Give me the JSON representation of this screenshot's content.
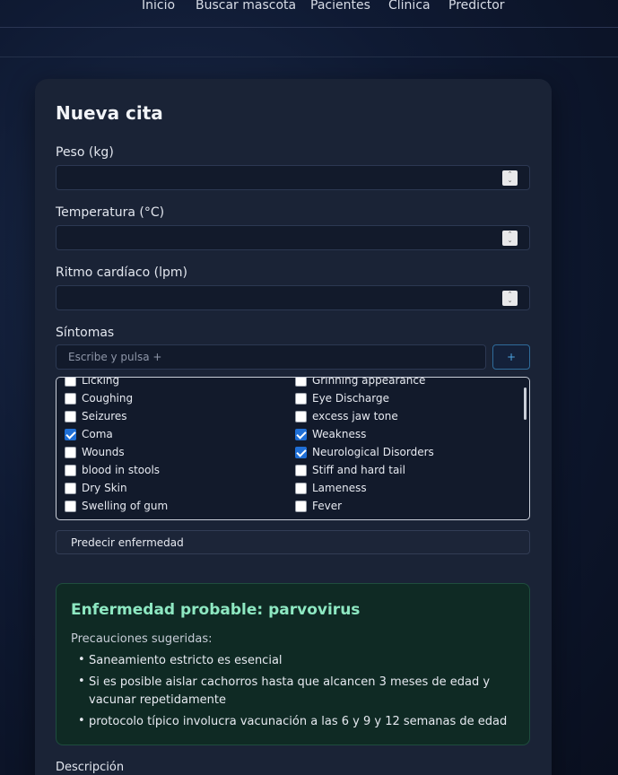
{
  "nav": {
    "items": [
      "Inicio",
      "Buscar mascota",
      "Pacientes",
      "Clínica",
      "Predictor"
    ]
  },
  "form": {
    "title": "Nueva cita",
    "weight_label": "Peso (kg)",
    "temperature_label": "Temperatura (°C)",
    "heart_rate_label": "Ritmo cardíaco (lpm)",
    "symptoms_label": "Síntomas",
    "symptom_placeholder": "Escribe y pulsa +",
    "add_label": "+",
    "predict_label": "Predecir enfermedad",
    "description_label": "Descripción"
  },
  "symptoms": {
    "left": [
      {
        "label": "Licking",
        "checked": false
      },
      {
        "label": "Coughing",
        "checked": false
      },
      {
        "label": "Seizures",
        "checked": false
      },
      {
        "label": "Coma",
        "checked": true
      },
      {
        "label": "Wounds",
        "checked": false
      },
      {
        "label": "blood in stools",
        "checked": false
      },
      {
        "label": "Dry Skin",
        "checked": false
      },
      {
        "label": "Swelling of gum",
        "checked": false
      }
    ],
    "right": [
      {
        "label": "Grinning appearance",
        "checked": false
      },
      {
        "label": "Eye Discharge",
        "checked": false
      },
      {
        "label": "excess jaw tone",
        "checked": false
      },
      {
        "label": "Weakness",
        "checked": true
      },
      {
        "label": "Neurological Disorders",
        "checked": true
      },
      {
        "label": "Stiff and hard tail",
        "checked": false
      },
      {
        "label": "Lameness",
        "checked": false
      },
      {
        "label": "Fever",
        "checked": false
      }
    ]
  },
  "result": {
    "title": "Enfermedad probable: parvovirus",
    "precautions_label": "Precauciones sugeridas:",
    "precautions": [
      "Saneamiento estricto es esencial",
      "Si es posible aislar cachorros hasta que alcancen 3 meses de edad y vacunar repetidamente",
      "protocolo típico involucra vacunación a las 6 y 9 y 12 semanas de edad"
    ]
  },
  "colors": {
    "accent": "#4da3e0",
    "checkbox_checked": "#1f6fd6",
    "result_title": "#8ee8c2"
  }
}
